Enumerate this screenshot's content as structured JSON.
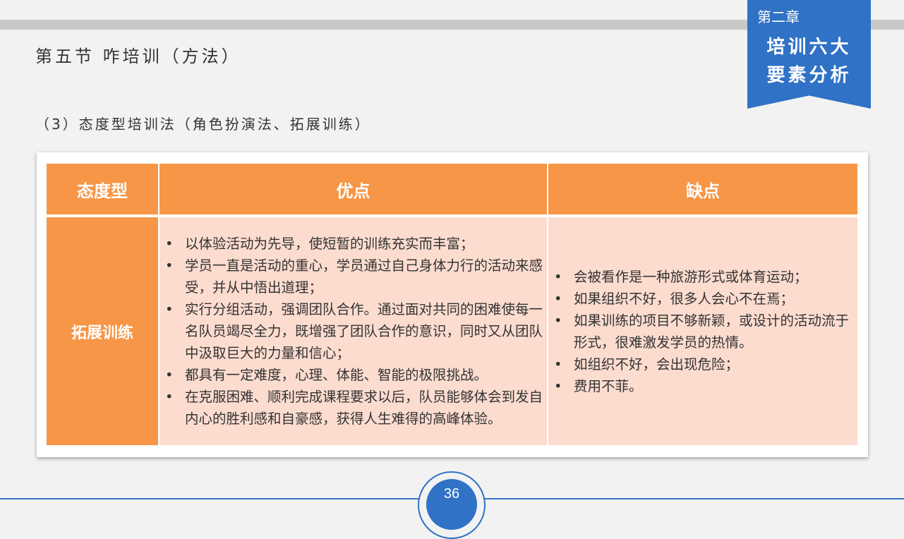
{
  "chapter": {
    "number": "第二章",
    "title_line1": "培训六大",
    "title_line2": "要素分析"
  },
  "section_title": "第五节  咋培训（方法）",
  "sub_title": "（3）态度型培训法（角色扮演法、拓展训练）",
  "table": {
    "headers": [
      "态度型",
      "优点",
      "缺点"
    ],
    "row_label": "拓展训练",
    "advantages": [
      "以体验活动为先导，使短暂的训练充实而丰富；",
      "学员一直是活动的重心，学员通过自己身体力行的活动来感受，并从中悟出道理；",
      "实行分组活动，强调团队合作。通过面对共同的困难使每一名队员竭尽全力，既增强了团队合作的意识，同时又从团队中汲取巨大的力量和信心；",
      "都具有一定难度，心理、体能、智能的极限挑战。",
      "在克服困难、顺利完成课程要求以后，队员能够体会到发自内心的胜利感和自豪感，获得人生难得的高峰体验。"
    ],
    "disadvantages": [
      "会被看作是一种旅游形式或体育运动；",
      "如果组织不好，很多人会心不在焉；",
      "如果训练的项目不够新颖，或设计的活动流于形式，很难激发学员的热情。",
      "如组织不好，会出现危险；",
      "费用不菲。"
    ]
  },
  "page_number": "36",
  "colors": {
    "accent_blue": "#2f72c6",
    "header_orange": "#f79646",
    "body_peach": "#fcdccf"
  }
}
